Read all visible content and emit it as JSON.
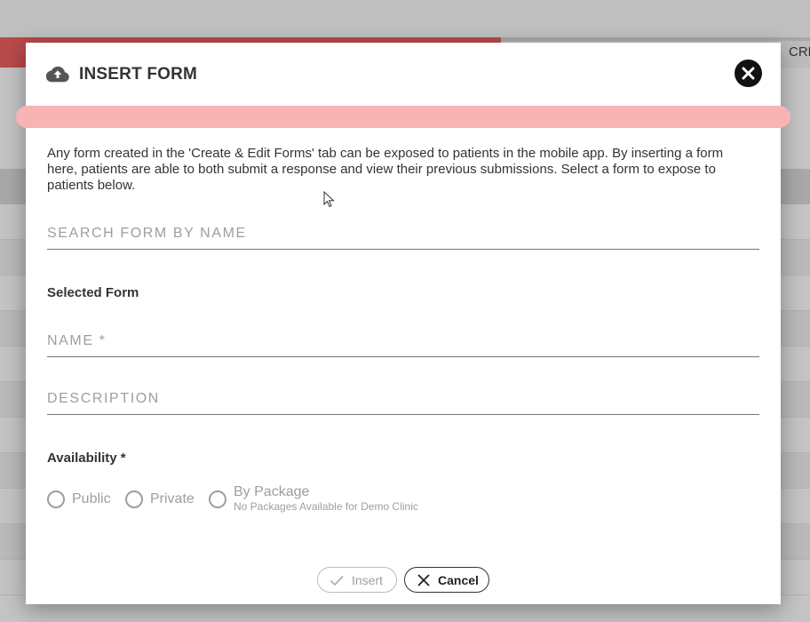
{
  "background": {
    "tab_label": "CRE",
    "colors": {
      "red_bar": "#b84a4a",
      "overlay": "#c4c4c4"
    }
  },
  "modal": {
    "header": {
      "icon": "cloud-upload-icon",
      "title": "INSERT FORM",
      "close_icon": "close-icon"
    },
    "progress": {
      "value": 0,
      "track_color": "#f8b4b4"
    },
    "intro_text": "Any form created in the 'Create & Edit Forms' tab can be exposed to patients in the mobile app. By inserting a form here, patients are able to both submit a response and view their previous submissions. Select a form to expose to patients below.",
    "search": {
      "placeholder": "SEARCH FORM BY NAME",
      "value": ""
    },
    "selected_form": {
      "label": "Selected Form",
      "name_placeholder": "NAME *",
      "name_value": "",
      "description_placeholder": "DESCRIPTION",
      "description_value": ""
    },
    "availability": {
      "label": "Availability *",
      "options": [
        {
          "label": "Public",
          "sub": ""
        },
        {
          "label": "Private",
          "sub": ""
        },
        {
          "label": "By Package",
          "sub": "No Packages Available for Demo Clinic"
        }
      ]
    },
    "buttons": {
      "insert_label": "Insert",
      "insert_icon": "check-icon",
      "cancel_label": "Cancel",
      "cancel_icon": "x-icon"
    }
  }
}
